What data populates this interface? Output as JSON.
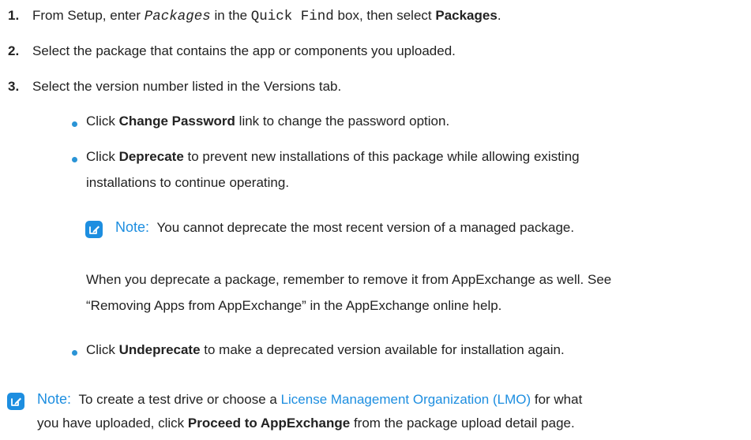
{
  "steps": [
    {
      "number": "1.",
      "text_a": "From Setup, enter ",
      "code_a": "Packages",
      "text_b": " in the ",
      "code_b": "Quick Find",
      "text_c": " box, then select ",
      "bold": "Packages",
      "text_d": "."
    },
    {
      "number": "2.",
      "text": "Select the package that contains the app or components you uploaded."
    },
    {
      "number": "3.",
      "text": "Select the version number listed in the Versions tab."
    }
  ],
  "bullets": [
    {
      "pre": "Click ",
      "bold": "Change Password",
      "post": " link to change the password option."
    },
    {
      "pre": "Click ",
      "bold": "Deprecate",
      "post": " to prevent new installations of this package while allowing existing",
      "line2": "installations to continue operating."
    },
    {
      "pre": "Click ",
      "bold": "Undeprecate",
      "post": " to make a deprecated version available for installation again."
    }
  ],
  "inner_note": {
    "label": "Note:",
    "text": "You cannot deprecate the most recent version of a managed package."
  },
  "deprecate_paragraph": {
    "line1": "When you deprecate a package, remember to remove it from AppExchange as well. See",
    "line2": "“Removing Apps from AppExchange” in the AppExchange online help."
  },
  "bottom_note": {
    "label": "Note:",
    "text_a": "To create a test drive or choose a ",
    "link": "License Management Organization (LMO)",
    "text_b": " for what",
    "text_c": "you have uploaded, click ",
    "bold": "Proceed to AppExchange",
    "text_d": " from the package upload detail page."
  },
  "colors": {
    "accent": "#1d8ee0",
    "bullet": "#2a94d6",
    "text": "#222222"
  },
  "icons": {
    "note": "note-edit-icon"
  }
}
